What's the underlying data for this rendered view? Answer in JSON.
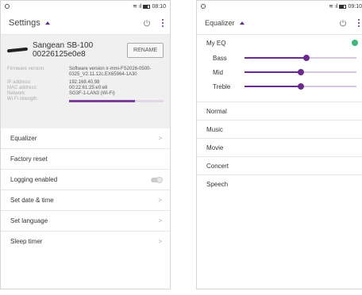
{
  "left": {
    "status_time": "08:10",
    "title": "Settings",
    "device": {
      "name_line1": "Sangean SB-100",
      "name_line2": "00226125e0e8",
      "rename_label": "RENAME",
      "info": [
        {
          "key": "Firmware version:",
          "value": "Software version ir-mmi-FS2026-0500-0325_V2.11.12c.EX65964-1A30"
        },
        {
          "key": "IP address:",
          "value": "192.168.40.98"
        },
        {
          "key": "MAC address:",
          "value": "00:22:61:25:e0:e8"
        },
        {
          "key": "Network:",
          "value": "SG3F-1-LAN3 (Wi-Fi)"
        },
        {
          "key": "Wi-Fi strength:",
          "value": ""
        }
      ],
      "wifi_strength_fraction": 0.7
    },
    "menu": [
      {
        "label": "Equalizer",
        "chevron": ">"
      },
      {
        "label": "Factory reset",
        "chevron": ""
      },
      {
        "label": "Logging enabled",
        "toggle": "off"
      },
      {
        "label": "Set date & time",
        "chevron": ">"
      },
      {
        "label": "Set language",
        "chevron": ">"
      },
      {
        "label": "Sleep timer",
        "chevron": ">"
      }
    ]
  },
  "right": {
    "status_time": "09:10",
    "title": "Equalizer",
    "my_eq": "My EQ",
    "bands": [
      {
        "label": "Bass",
        "level": 0.55
      },
      {
        "label": "Mid",
        "level": 0.5
      },
      {
        "label": "Treble",
        "level": 0.5
      }
    ],
    "presets": [
      "Normal",
      "Music",
      "Movie",
      "Concert",
      "Speech"
    ]
  },
  "colors": {
    "accent": "#6a2a8f",
    "check": "#3cb878"
  }
}
